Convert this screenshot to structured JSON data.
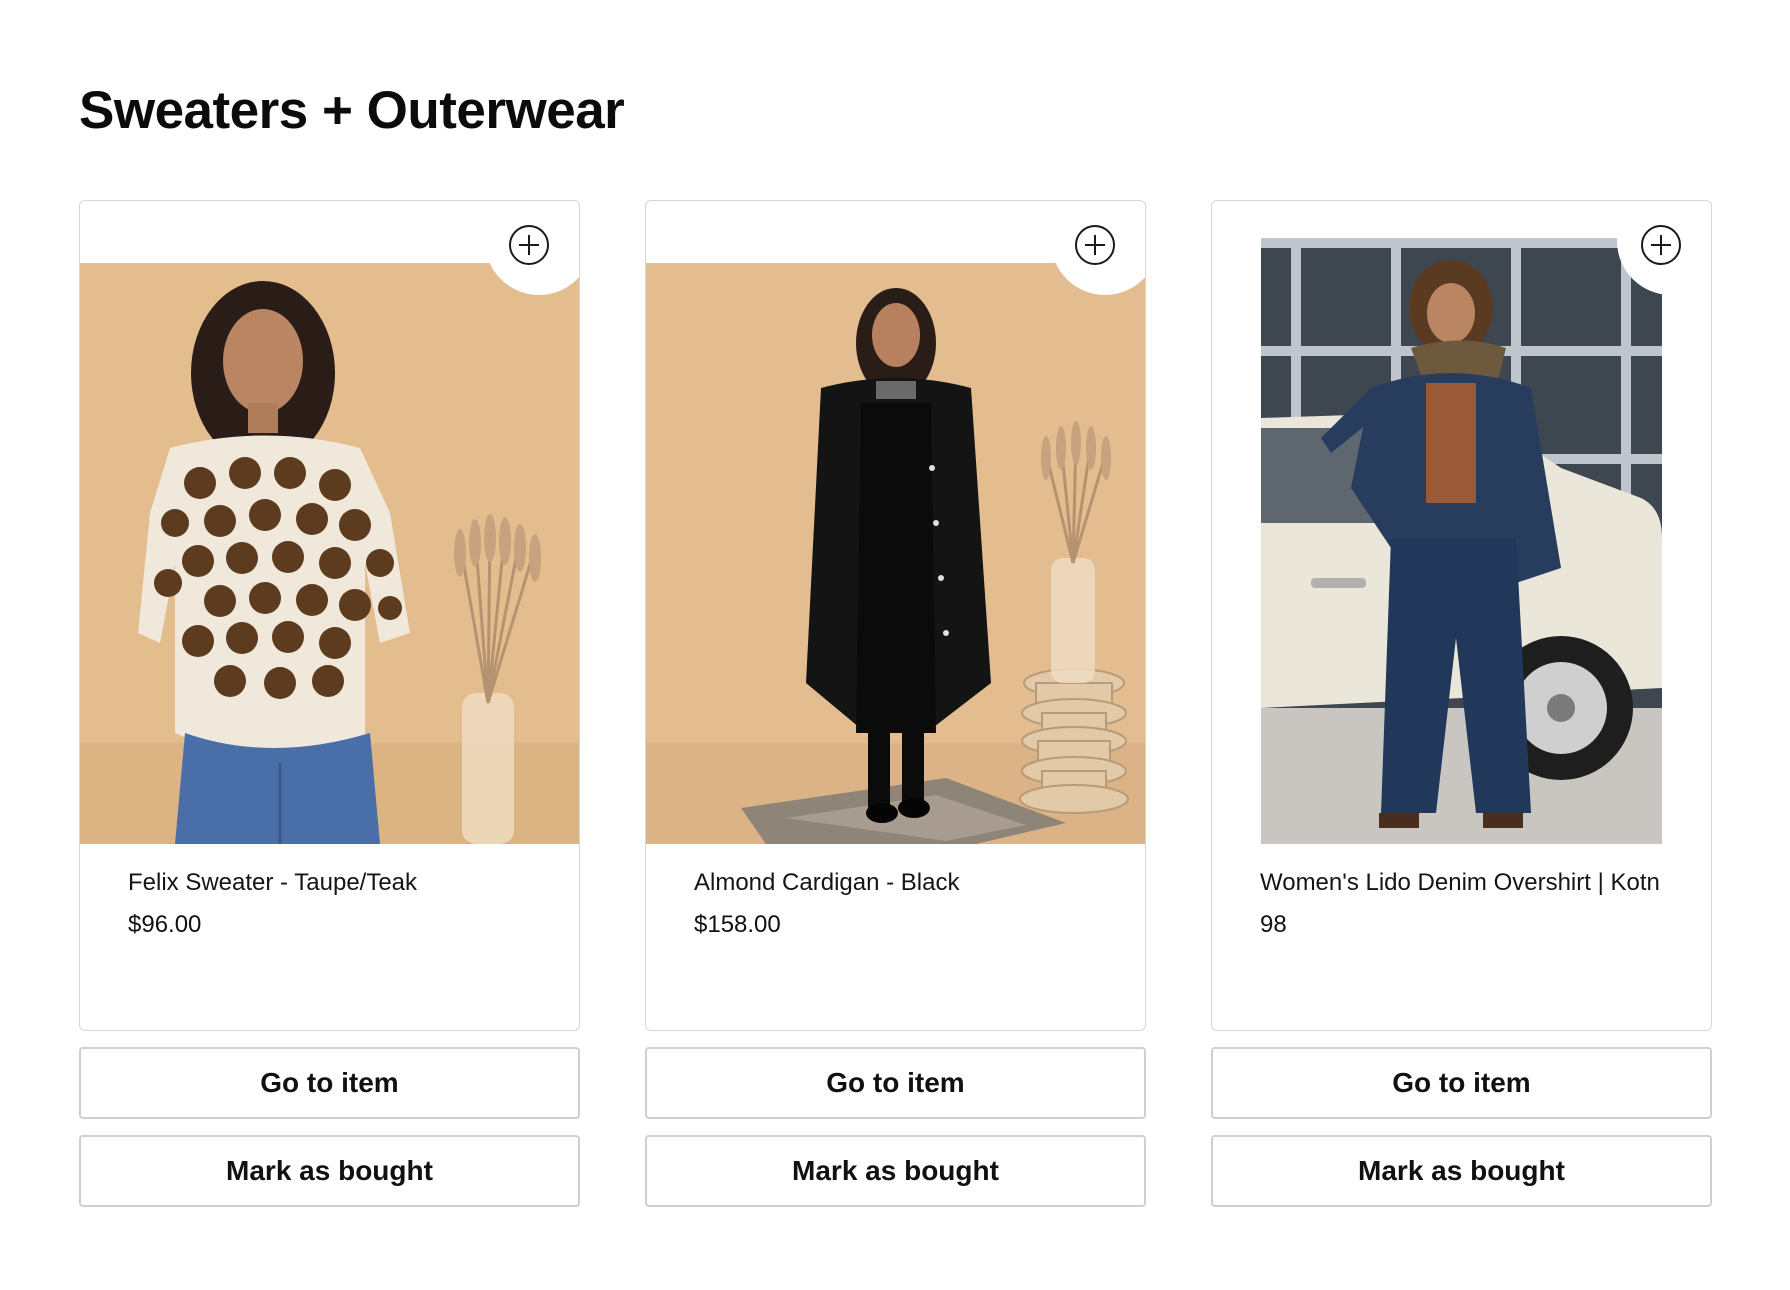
{
  "page": {
    "title": "Sweaters + Outerwear"
  },
  "buttons": {
    "go_to_item": "Go to item",
    "mark_as_bought": "Mark as bought"
  },
  "products": [
    {
      "name": "Felix Sweater - Taupe/Teak",
      "price": "$96.00",
      "add_icon": "plus-circle-icon"
    },
    {
      "name": "Almond Cardigan - Black",
      "price": "$158.00",
      "add_icon": "plus-circle-icon"
    },
    {
      "name": "Women's Lido Denim Overshirt | Kotn",
      "price": "98",
      "add_icon": "plus-circle-icon"
    }
  ],
  "colors": {
    "background": "#ffffff",
    "text": "#111111",
    "border": "#d6d6d6",
    "photo_backdrop": "#e3bd8f"
  }
}
